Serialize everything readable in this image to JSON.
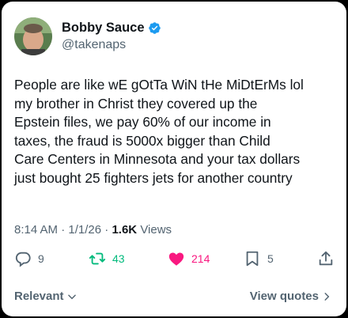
{
  "author": {
    "display_name": "Bobby Sauce",
    "handle": "@takenaps",
    "verified_icon": "verified-badge-icon",
    "verified_color": "#1d9bf0"
  },
  "tweet": {
    "text": "People are like wE gOtTa WiN tHe MiDtErMs lol\nmy brother in Christ they covered up the\nEpstein files, we pay 60% of our income in\ntaxes,  the fraud is 5000x bigger than Child\nCare Centers in Minnesota and your tax dollars\njust bought 25 fighters jets for  another country"
  },
  "meta": {
    "time": "8:14 AM",
    "separator": "·",
    "date": "1/1/26",
    "views_count": "1.6K",
    "views_label": "Views"
  },
  "actions": {
    "reply_count": "9",
    "retweet_count": "43",
    "like_count": "214",
    "bookmark_count": "5",
    "retweet_color": "#00ba7c",
    "like_color": "#f91880"
  },
  "footer": {
    "sort_label": "Relevant",
    "quotes_label": "View quotes"
  }
}
